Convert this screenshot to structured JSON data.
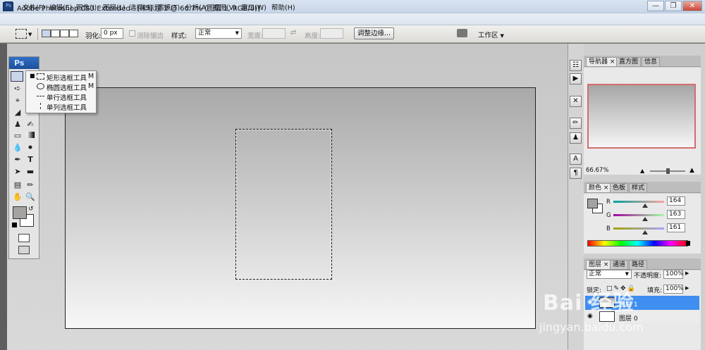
{
  "window": {
    "app_icon": "Ps",
    "title": "Adobe Photoshop CS3 Extended - [未标题-2 @ 66.7% (图层 1, RGB/8)]",
    "controls": [
      "minimize-icon",
      "restore-icon",
      "close-icon"
    ]
  },
  "menubar": {
    "items": [
      "文件(F)",
      "编辑(E)",
      "图像(I)",
      "图层(L)",
      "选择(S)",
      "滤镜(T)",
      "分析(A)",
      "视图(V)",
      "窗口(W)",
      "帮助(H)"
    ]
  },
  "options": {
    "feather_label": "羽化:",
    "feather_value": "0 px",
    "antialias_label": "消除锯齿",
    "style_label": "样式:",
    "style_value": "正常",
    "width_label": "宽度:",
    "height_label": "高度:",
    "refine_edge": "调整边缘...",
    "workspace": "工作区"
  },
  "toolbox": {
    "logo": "Ps",
    "foreground_color": "#a4a3a1",
    "background_color": "#ffffff"
  },
  "flyout": {
    "items": [
      {
        "label": "矩形选框工具",
        "shortcut": "M",
        "icon": "rect-marquee-icon",
        "selected": true
      },
      {
        "label": "椭圆选框工具",
        "shortcut": "M",
        "icon": "ellipse-marquee-icon",
        "selected": false
      },
      {
        "label": "单行选框工具",
        "shortcut": "",
        "icon": "single-row-marquee-icon",
        "selected": false
      },
      {
        "label": "单列选框工具",
        "shortcut": "",
        "icon": "single-column-marquee-icon",
        "selected": false
      }
    ]
  },
  "navigator": {
    "tabs": [
      "导航器",
      "直方图",
      "信息"
    ],
    "zoom": "66.67%"
  },
  "color_panel": {
    "tabs": [
      "颜色",
      "色板",
      "样式"
    ],
    "channels": [
      {
        "name": "R",
        "value": "164"
      },
      {
        "name": "G",
        "value": "163"
      },
      {
        "name": "B",
        "value": "161"
      }
    ]
  },
  "layers_panel": {
    "tabs": [
      "图层",
      "通道",
      "路径"
    ],
    "blend_mode": "正常",
    "opacity_label": "不透明度:",
    "opacity_value": "100%",
    "lock_label": "锁定:",
    "fill_label": "填充:",
    "fill_value": "100%",
    "layers": [
      {
        "name": "图层 1",
        "selected": true
      },
      {
        "name": "图层 0",
        "selected": false
      }
    ]
  },
  "watermark": {
    "text": "Bai 经验",
    "url": "jingyan.baidu.com"
  }
}
